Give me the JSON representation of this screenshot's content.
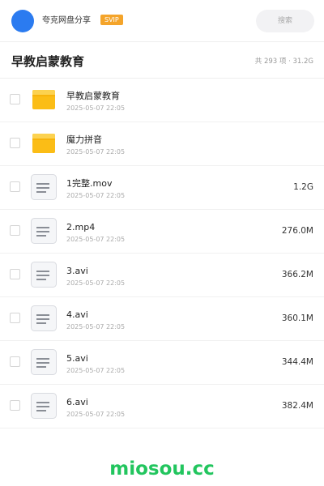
{
  "header": {
    "account_name": "夸克网盘分享",
    "vip_label": "SVIP",
    "search_placeholder": "搜索"
  },
  "folder": {
    "title": "早教启蒙教育",
    "summary": "共 293 项 · 31.2G"
  },
  "files": [
    {
      "name": "早教启蒙教育",
      "date": "2025-05-07 22:05",
      "size": "",
      "icon": "folder-icon"
    },
    {
      "name": "魔力拼音",
      "date": "2025-05-07 22:05",
      "size": "",
      "icon": "folder-icon"
    },
    {
      "name": "1完整.mov",
      "date": "2025-05-07 22:05",
      "size": "1.2G",
      "icon": "document-icon"
    },
    {
      "name": "2.mp4",
      "date": "2025-05-07 22:05",
      "size": "276.0M",
      "icon": "document-icon"
    },
    {
      "name": "3.avi",
      "date": "2025-05-07 22:05",
      "size": "366.2M",
      "icon": "document-icon"
    },
    {
      "name": "4.avi",
      "date": "2025-05-07 22:05",
      "size": "360.1M",
      "icon": "document-icon"
    },
    {
      "name": "5.avi",
      "date": "2025-05-07 22:05",
      "size": "344.4M",
      "icon": "document-icon"
    },
    {
      "name": "6.avi",
      "date": "2025-05-07 22:05",
      "size": "382.4M",
      "icon": "document-icon"
    }
  ],
  "watermark": "miosou.cc",
  "colors": {
    "accent": "#2b7bf0",
    "vip": "#f4a42a",
    "folder": "#fbbd16",
    "watermark": "#22c55e"
  }
}
